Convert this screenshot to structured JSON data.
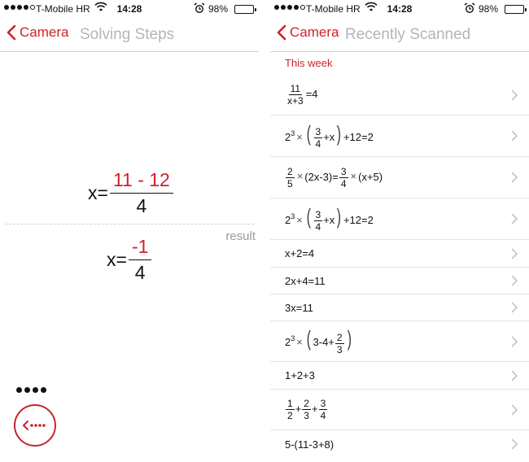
{
  "status_bar": {
    "carrier": "T-Mobile HR",
    "time": "14:28",
    "battery_percent": "98%",
    "battery_level": 0.98
  },
  "left": {
    "nav": {
      "back_label": "Camera",
      "title": "Solving Steps"
    },
    "step": {
      "lhs": "x",
      "equals": "=",
      "numerator": "11 - 12",
      "denominator": "4"
    },
    "result_label": "result",
    "result": {
      "lhs": "x",
      "equals": "=",
      "numerator": "-1",
      "denominator": "4"
    },
    "accent_color": "#d0212a"
  },
  "right": {
    "nav": {
      "back_label": "Camera",
      "title": "Recently Scanned"
    },
    "section_label": "This week"
  }
}
